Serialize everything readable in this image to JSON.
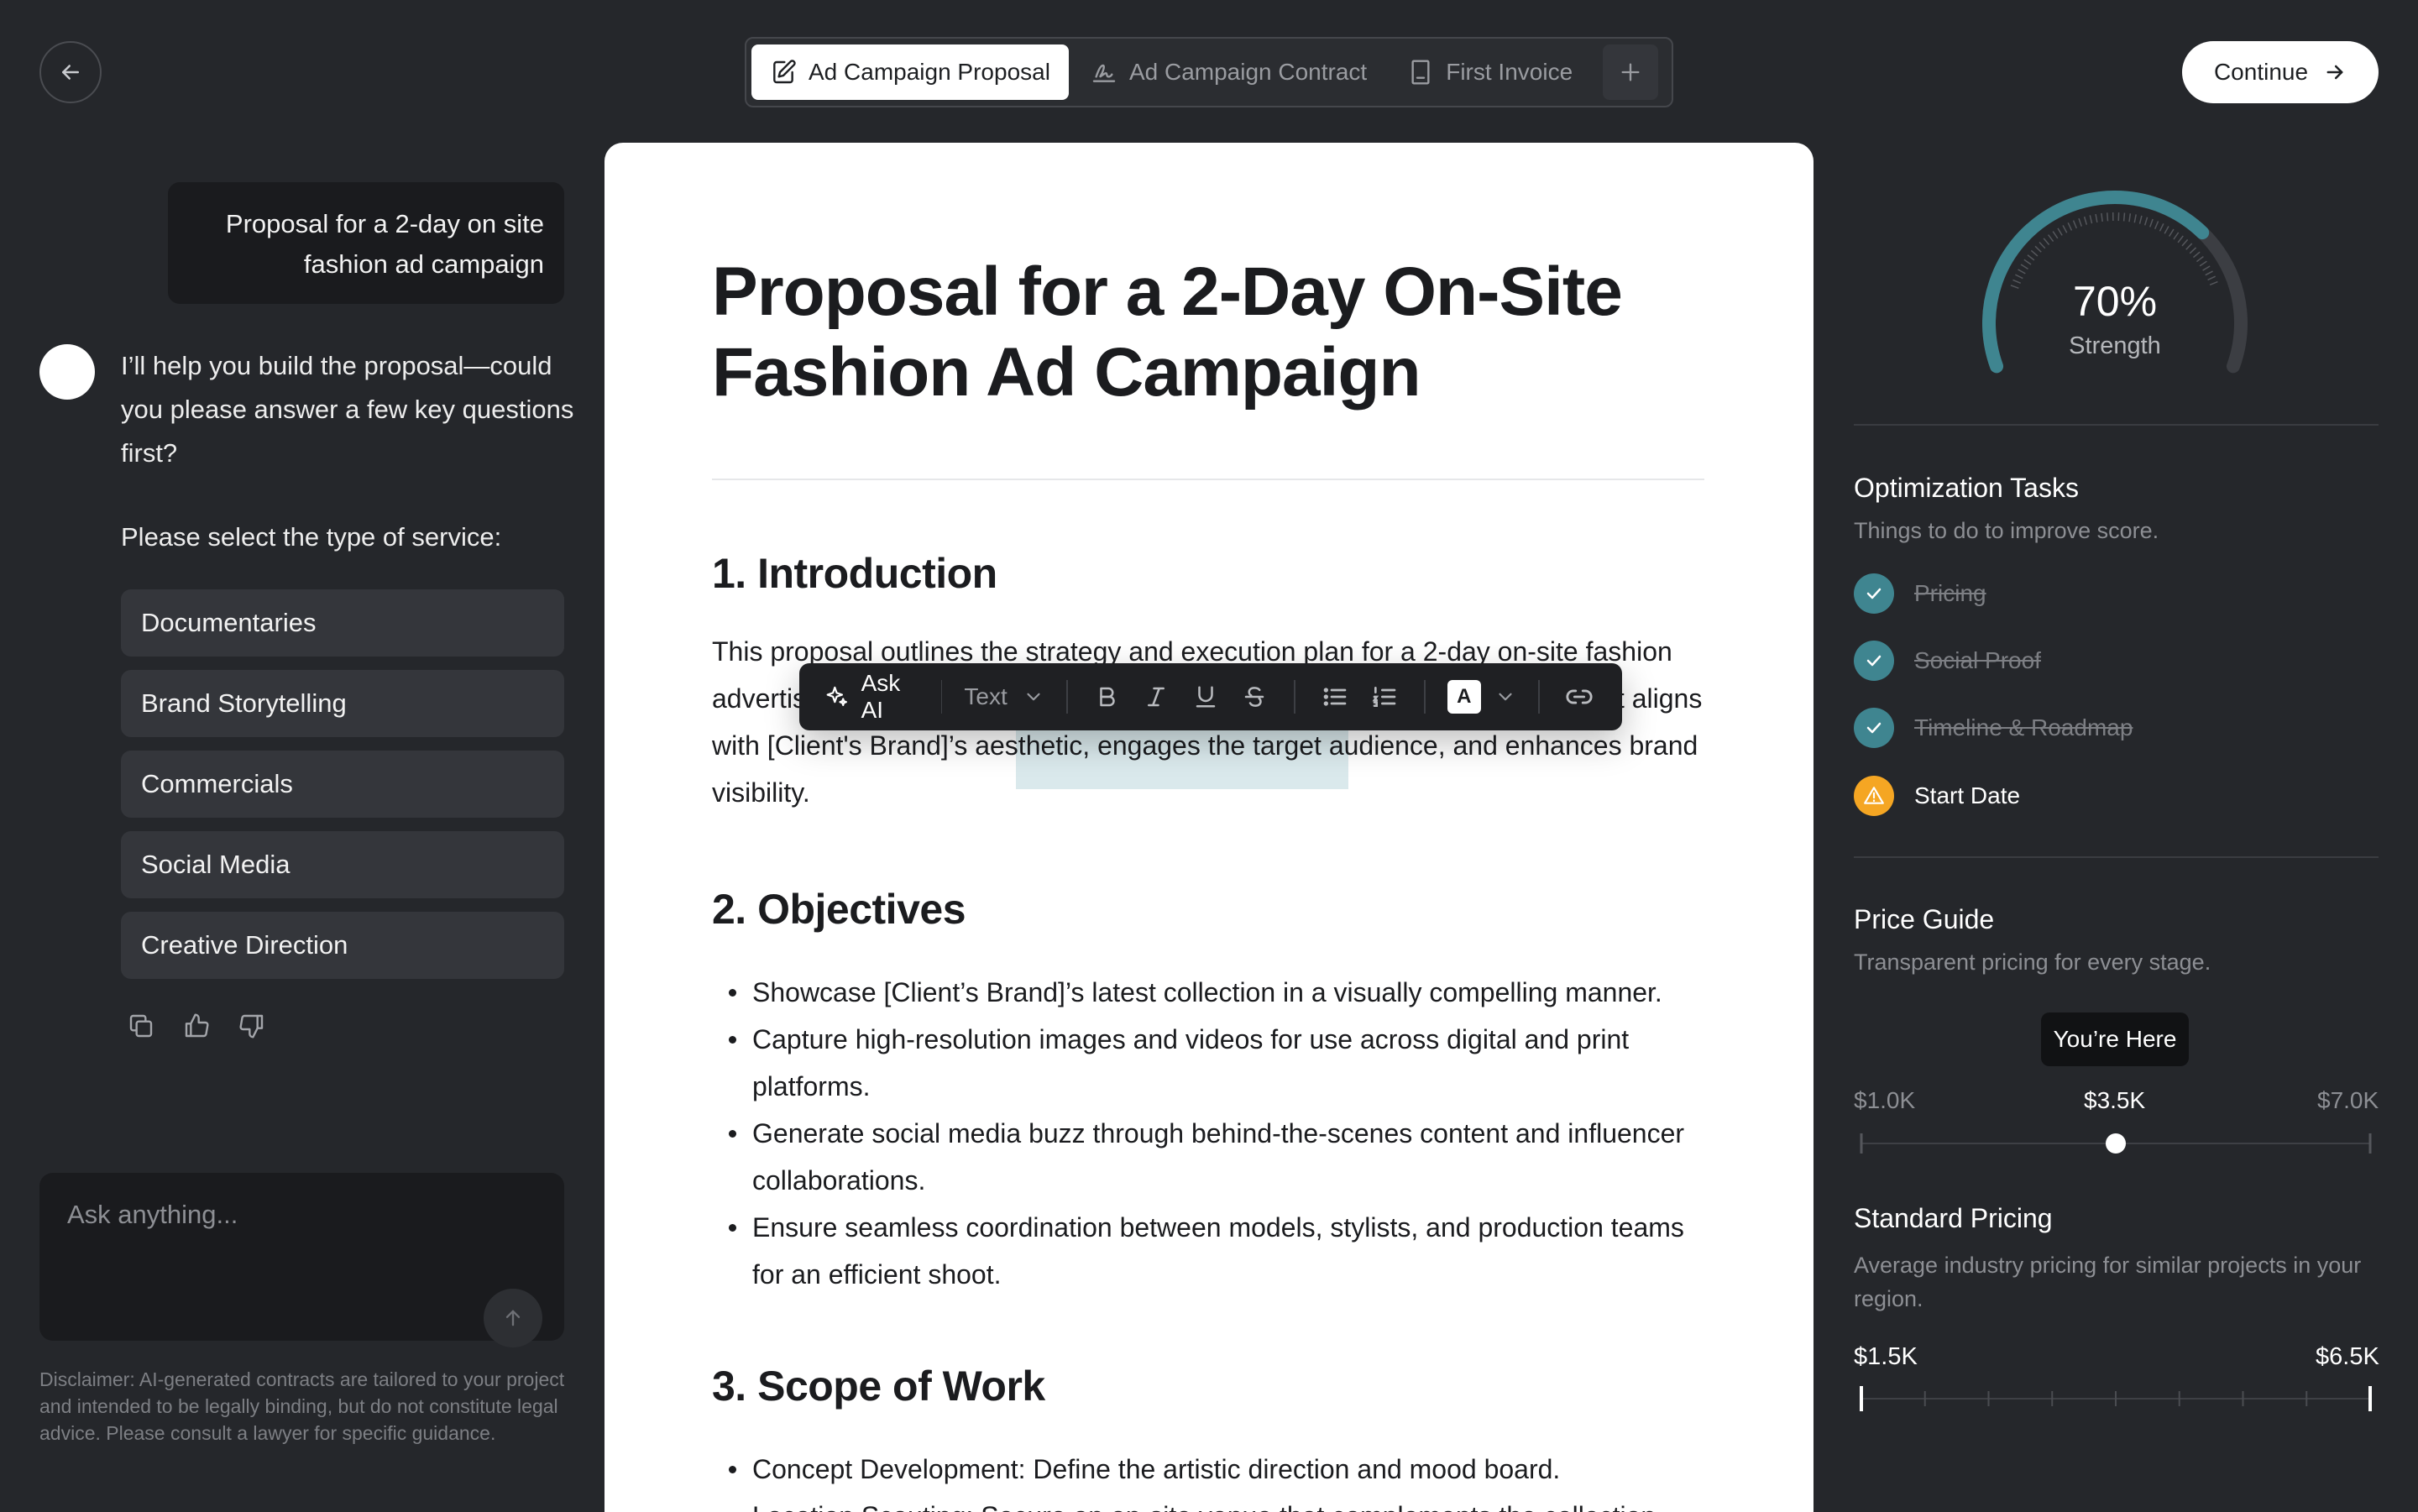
{
  "header": {
    "back_icon": "arrow-left-icon",
    "tabs": [
      {
        "label": "Ad Campaign Proposal",
        "icon": "edit-document-icon",
        "active": true
      },
      {
        "label": "Ad Campaign Contract",
        "icon": "signature-icon",
        "active": false
      },
      {
        "label": "First Invoice",
        "icon": "invoice-icon",
        "active": false
      }
    ],
    "add_icon": "plus-icon",
    "continue_label": "Continue"
  },
  "chat": {
    "user_message": "Proposal for a 2-day on site fashion ad campaign",
    "ai_message": "I’ll help you build the proposal—could you please answer a few key questions first?",
    "service_prompt": "Please select the type of service:",
    "options": [
      "Documentaries",
      "Brand Storytelling",
      "Commercials",
      "Social Media",
      "Creative Direction"
    ],
    "input_placeholder": "Ask anything...",
    "disclaimer": "Disclaimer: AI-generated contracts are tailored to your project and intended to be legally binding, but do not constitute legal advice. Please consult a lawyer for specific guidance."
  },
  "document": {
    "title": "Proposal for a 2-Day On-Site Fashion Ad Campaign",
    "sections": [
      {
        "heading": "1. Introduction",
        "body": "This proposal outlines the strategy and execution plan for a 2-day on-site fashion advertising campaign. Our approach ensures a cohesive visual narrative that aligns with [Client's Brand]’s aesthetic, engages the target audience, and enhances brand visibility."
      },
      {
        "heading": "2. Objectives",
        "items": [
          "Showcase [Client’s Brand]’s latest collection in a visually compelling manner.",
          "Capture high-resolution images and videos for use across digital and print platforms.",
          "Generate social media buzz through behind-the-scenes content and influencer collaborations.",
          "Ensure seamless coordination between models, stylists, and production teams for an efficient shoot."
        ]
      },
      {
        "heading": "3. Scope of Work",
        "items": [
          "Concept Development: Define the artistic direction and mood board.",
          "Location Scouting: Secure an on-site venue that complements the collection."
        ]
      }
    ]
  },
  "toolbar": {
    "ask_ai_label": "Ask AI",
    "text_style_label": "Text",
    "buttons": [
      "bold-icon",
      "italic-icon",
      "underline-icon",
      "strikethrough-icon",
      "bullet-list-icon",
      "numbered-list-icon",
      "text-color-icon",
      "link-icon"
    ],
    "color_letter": "A"
  },
  "score": {
    "value": 70,
    "value_label": "70%",
    "label": "Strength",
    "color": "#3f8590"
  },
  "optimization": {
    "title": "Optimization Tasks",
    "subtitle": "Things to do to improve score.",
    "tasks": [
      {
        "label": "Pricing",
        "done": true
      },
      {
        "label": "Social Proof",
        "done": true
      },
      {
        "label": "Timeline & Roadmap",
        "done": true
      },
      {
        "label": "Start Date",
        "done": false,
        "status": "warning"
      }
    ],
    "done_color": "#3f8590",
    "warn_color": "#f5a623"
  },
  "price_guide": {
    "title": "Price Guide",
    "subtitle": "Transparent pricing for every stage.",
    "tooltip": "You’re Here",
    "min_label": "$1.0K",
    "current_label": "$3.5K",
    "max_label": "$7.0K",
    "current_fraction": 0.5
  },
  "standard_pricing": {
    "title": "Standard Pricing",
    "subtitle": "Average industry pricing for similar projects in your region.",
    "min_label": "$1.5K",
    "max_label": "$6.5K",
    "tick_count": 9
  }
}
